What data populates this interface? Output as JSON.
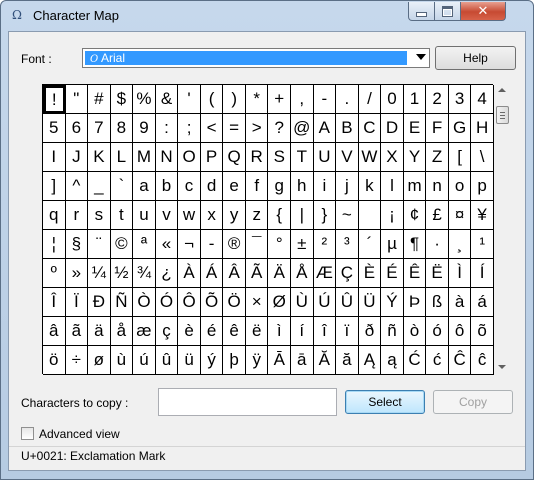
{
  "window": {
    "title": "Character Map",
    "close_glyph": "✕"
  },
  "font": {
    "label": "Font :",
    "selected": "Arial",
    "type_icon_glyph": "O"
  },
  "buttons": {
    "help": "Help",
    "select": "Select",
    "copy": "Copy"
  },
  "copy_row": {
    "label": "Characters to copy :",
    "value": ""
  },
  "advanced": {
    "label": "Advanced view",
    "checked": false
  },
  "status": {
    "text": "U+0021: Exclamation Mark"
  },
  "selected_index": 0,
  "characters": [
    "!",
    "\"",
    "#",
    "$",
    "%",
    "&",
    "'",
    "(",
    ")",
    "*",
    "+",
    ",",
    "-",
    ".",
    "/",
    "0",
    "1",
    "2",
    "3",
    "4",
    "5",
    "6",
    "7",
    "8",
    "9",
    ":",
    ";",
    "<",
    "=",
    ">",
    "?",
    "@",
    "A",
    "B",
    "C",
    "D",
    "E",
    "F",
    "G",
    "H",
    "I",
    "J",
    "K",
    "L",
    "M",
    "N",
    "O",
    "P",
    "Q",
    "R",
    "S",
    "T",
    "U",
    "V",
    "W",
    "X",
    "Y",
    "Z",
    "[",
    "\\",
    "]",
    "^",
    "_",
    "`",
    "a",
    "b",
    "c",
    "d",
    "e",
    "f",
    "g",
    "h",
    "i",
    "j",
    "k",
    "l",
    "m",
    "n",
    "o",
    "p",
    "q",
    "r",
    "s",
    "t",
    "u",
    "v",
    "w",
    "x",
    "y",
    "z",
    "{",
    "|",
    "}",
    "~",
    " ",
    "¡",
    "¢",
    "£",
    "¤",
    "¥",
    "¦",
    "§",
    "¨",
    "©",
    "ª",
    "«",
    "¬",
    "-",
    "®",
    "¯",
    "°",
    "±",
    "²",
    "³",
    "´",
    "µ",
    "¶",
    "·",
    "¸",
    "¹",
    "º",
    "»",
    "¼",
    "½",
    "¾",
    "¿",
    "À",
    "Á",
    "Â",
    "Ã",
    "Ä",
    "Å",
    "Æ",
    "Ç",
    "È",
    "É",
    "Ê",
    "Ë",
    "Ì",
    "Í",
    "Î",
    "Ï",
    "Ð",
    "Ñ",
    "Ò",
    "Ó",
    "Ô",
    "Õ",
    "Ö",
    "×",
    "Ø",
    "Ù",
    "Ú",
    "Û",
    "Ü",
    "Ý",
    "Þ",
    "ß",
    "à",
    "á",
    "â",
    "ã",
    "ä",
    "å",
    "æ",
    "ç",
    "è",
    "é",
    "ê",
    "ë",
    "ì",
    "í",
    "î",
    "ï",
    "ð",
    "ñ",
    "ò",
    "ó",
    "ô",
    "õ",
    "ö",
    "÷",
    "ø",
    "ù",
    "ú",
    "û",
    "ü",
    "ý",
    "þ",
    "ÿ",
    "Ā",
    "ā",
    "Ă",
    "ă",
    "Ą",
    "ą",
    "Ć",
    "ć",
    "Ĉ",
    "ĉ"
  ]
}
